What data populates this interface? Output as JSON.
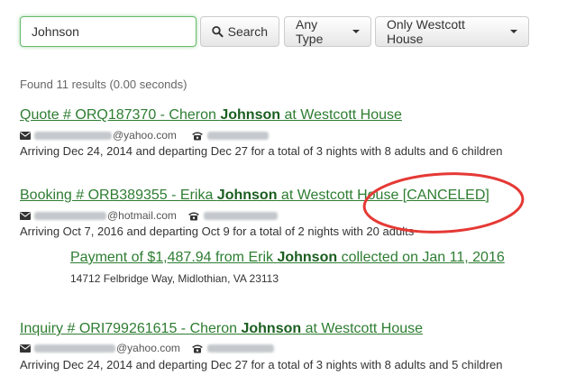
{
  "search": {
    "value": "Johnson",
    "button_label": "Search"
  },
  "filters": {
    "type_label": "Any Type",
    "location_label": "Only Westcott House"
  },
  "summary": "Found 11 results (0.00 seconds)",
  "results": [
    {
      "prefix": "Quote # ORQ187370 - Cheron ",
      "name": "Johnson",
      "suffix": " at Westcott House",
      "email_domain": "@yahoo.com",
      "description": "Arriving Dec 24, 2014 and departing Dec 27 for a total of 3 nights with 8 adults and 6 children"
    },
    {
      "prefix": "Booking # ORB389355 - Erika ",
      "name": "Johnson",
      "suffix": " at Westcott House [CANCELED]",
      "email_domain": "@hotmail.com",
      "description": "Arriving Oct 7, 2016 and departing Oct 9 for a total of 2 nights with 20 adults"
    },
    {
      "prefix": "Inquiry # ORI799261615 - Cheron ",
      "name": "Johnson",
      "suffix": " at Westcott House",
      "email_domain": "@yahoo.com",
      "description": "Arriving Dec 24, 2014 and departing Dec 27 for a total of 3 nights with 8 adults and 5 children"
    }
  ],
  "payment": {
    "prefix": "Payment of $1,487.94 from Erik ",
    "name": "Johnson",
    "suffix": " collected on Jan 11, 2016",
    "address": "14712 Felbridge Way, Midlothian, VA 23113"
  },
  "colors": {
    "link": "#2e7d32",
    "annotation": "#e53935"
  }
}
